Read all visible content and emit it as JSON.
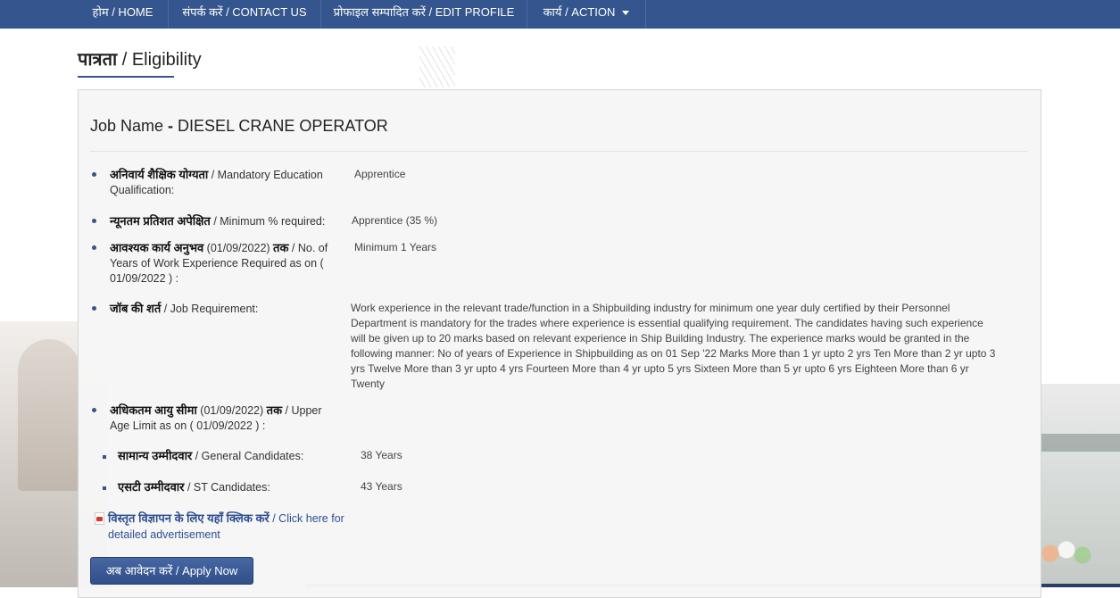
{
  "nav": {
    "home": "होम / HOME",
    "contact": "संपर्क करें / CONTACT US",
    "edit_profile": "प्रोफाइल सम्पादित करें / EDIT PROFILE",
    "action": "कार्य / ACTION"
  },
  "page": {
    "title_hi": "पात्रता",
    "title_en": " / Eligibility"
  },
  "job": {
    "name_label": "Job Name ",
    "name_sep": "- ",
    "name_value": "DIESEL CRANE OPERATOR"
  },
  "fields": {
    "education": {
      "label_hi": "अनिवार्य शैक्षिक योग्यता",
      "label_en": " / Mandatory Education Qualification:",
      "value": "Apprentice"
    },
    "min_percent": {
      "label_hi": "न्यूनतम प्रतिशत अपेक्षित",
      "label_en": " / Minimum % required:",
      "value": "Apprentice (35 %)"
    },
    "experience": {
      "label_hi": "आवश्यक कार्य अनुभव",
      "label_mid": " (01/09/2022) ",
      "label_hi2": "तक",
      "label_en": " / No. of Years of Work Experience Required as on ( 01/09/2022 ) :",
      "value": "Minimum 1 Years"
    },
    "job_requirement": {
      "label_hi": "जॉब की शर्त",
      "label_en": " / Job Requirement:",
      "value": " Work experience in the relevant trade/function in a Shipbuilding industry for minimum one year duly certified by their Personnel Department is mandatory for the trades where experience is essential qualifying requirement. The candidates having such experience will be given up to 20 marks based on relevant experience in Ship Building Industry. The experience marks would be granted in the following manner: No of years of Experience in Shipbuilding as on 01 Sep '22 Marks More than 1 yr upto 2 yrs Ten More than 2 yr upto 3 yrs Twelve More than 3 yr upto 4 yrs Fourteen More than 4 yr upto 5 yrs Sixteen More than 5 yr upto 6 yrs Eighteen More than 6 yr Twenty"
    },
    "upper_age": {
      "label_hi": "अधिकतम आयु सीमा",
      "label_mid": " (01/09/2022) ",
      "label_hi2": "तक",
      "label_en": " / Upper Age Limit as on ( 01/09/2022 ) :"
    },
    "general": {
      "label_hi": "सामान्य उम्मीदवार",
      "label_en": " / General Candidates:",
      "value": "38 Years"
    },
    "st": {
      "label_hi": "एसटी उम्मीदवार",
      "label_en": " / ST Candidates:",
      "value": "43 Years"
    }
  },
  "advert_link": {
    "label_hi": "विस्तृत विज्ञापन के लिए यहाँ क्लिक करें",
    "label_en": " / Click here for detailed advertisement"
  },
  "apply_button": {
    "label_hi": "अब आवेदन करें",
    "label_en": " / Apply Now"
  },
  "colors": {
    "navbar": "#35558e",
    "accent": "#35558e",
    "link": "#2d4f8f"
  },
  "icons": [
    "caret-down-icon",
    "pdf-icon"
  ]
}
